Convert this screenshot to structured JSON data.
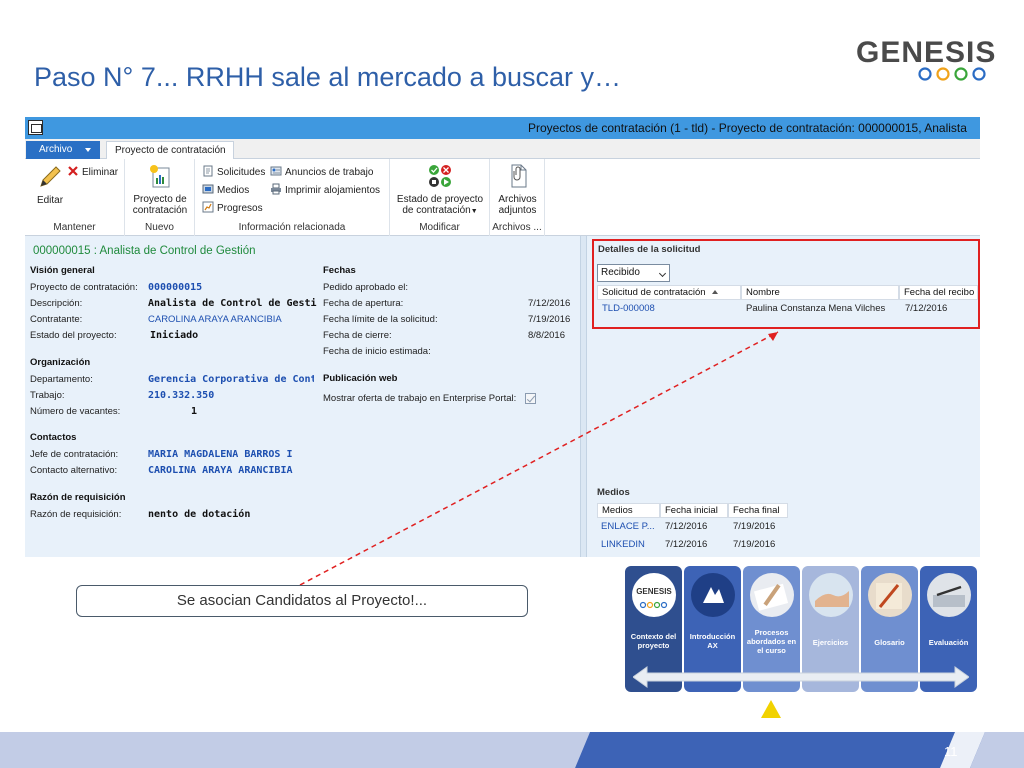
{
  "slide": {
    "title": "Paso N° 7... RRHH sale al mercado a buscar y…",
    "logo_text": "GENESIS",
    "callout": "Se asocian Candidatos al Proyecto!...",
    "page_number": "11"
  },
  "window": {
    "title": "Proyectos de contratación (1 - tld) - Proyecto de contratación: 000000015, Analista"
  },
  "tabs": {
    "file": "Archivo",
    "active": "Proyecto de contratación"
  },
  "ribbon": {
    "mantener": {
      "edit": "Editar",
      "delete": "Eliminar",
      "label": "Mantener"
    },
    "nuevo": {
      "button_line1": "Proyecto de",
      "button_line2": "contratación",
      "label": "Nuevo"
    },
    "info": {
      "solicitudes": "Solicitudes",
      "anuncios": "Anuncios de trabajo",
      "medios": "Medios",
      "imprimir": "Imprimir alojamientos",
      "progresos": "Progresos",
      "label": "Información relacionada"
    },
    "modificar": {
      "button_line1": "Estado de proyecto",
      "button_line2": "de contratación",
      "label": "Modificar"
    },
    "archivos": {
      "button_line1": "Archivos",
      "button_line2": "adjuntos",
      "label": "Archivos ..."
    }
  },
  "record": {
    "header": "000000015 : Analista de Control de Gestión",
    "vision_general": {
      "title": "Visión general",
      "proyecto_label": "Proyecto de contratación:",
      "proyecto_value": "000000015",
      "descripcion_label": "Descripción:",
      "descripcion_value": "Analista de Control de Gesti",
      "contratante_label": "Contratante:",
      "contratante_value": "CAROLINA ARAYA ARANCIBIA",
      "estado_label": "Estado del proyecto:",
      "estado_value": "Iniciado"
    },
    "organizacion": {
      "title": "Organización",
      "departamento_label": "Departamento:",
      "departamento_value": "Gerencia Corporativa de Contr",
      "trabajo_label": "Trabajo:",
      "trabajo_value": "210.332.350",
      "vacantes_label": "Número de vacantes:",
      "vacantes_value": "1"
    },
    "contactos": {
      "title": "Contactos",
      "jefe_label": "Jefe de contratación:",
      "jefe_value": "MARIA MAGDALENA BARROS I",
      "alternativo_label": "Contacto alternativo:",
      "alternativo_value": "CAROLINA ARAYA ARANCIBIA"
    },
    "razon": {
      "title": "Razón de requisición",
      "label": "Razón de requisición:",
      "value": "nento de dotación"
    },
    "fechas": {
      "title": "Fechas",
      "pedido_label": "Pedido aprobado el:",
      "apertura_label": "Fecha de apertura:",
      "apertura_value": "7/12/2016",
      "limite_label": "Fecha límite de la solicitud:",
      "limite_value": "7/19/2016",
      "cierre_label": "Fecha de cierre:",
      "cierre_value": "8/8/2016",
      "inicio_label": "Fecha de inicio estimada:"
    },
    "publicacion": {
      "title": "Publicación web",
      "label": "Mostrar oferta de trabajo en Enterprise Portal:"
    }
  },
  "solicitud_panel": {
    "title": "Detalles de la solicitud",
    "filter": "Recibido",
    "columns": [
      "Solicitud de contratación",
      "Nombre",
      "Fecha del recibo"
    ],
    "rows": [
      {
        "solicitud": "TLD-000008",
        "nombre": "Paulina Constanza Mena  Vilches",
        "fecha": "7/12/2016"
      }
    ]
  },
  "medios_panel": {
    "title": "Medios",
    "columns": [
      "Medios",
      "Fecha inicial",
      "Fecha final"
    ],
    "rows": [
      {
        "medio": "ENLACE P...",
        "inicial": "7/12/2016",
        "final": "7/19/2016"
      },
      {
        "medio": "LINKEDIN",
        "inicial": "7/12/2016",
        "final": "7/19/2016"
      }
    ]
  },
  "nav": {
    "logo_text": "GENESIS",
    "tiles": [
      {
        "label": "Contexto del proyecto"
      },
      {
        "label": "Introducción AX"
      },
      {
        "label": "Procesos abordados en el curso"
      },
      {
        "label": "Ejercicios"
      },
      {
        "label": "Glosario"
      },
      {
        "label": "Evaluación"
      }
    ]
  },
  "colors": {
    "title_blue": "#2e5fa8",
    "titlebar": "#3f98e0",
    "file_tab": "#2a70c5",
    "content_bg": "#e8f1fa",
    "highlight_red": "#e02020",
    "nav_dark": "#2f4f8f",
    "footer_blue": "#3d63b6"
  }
}
